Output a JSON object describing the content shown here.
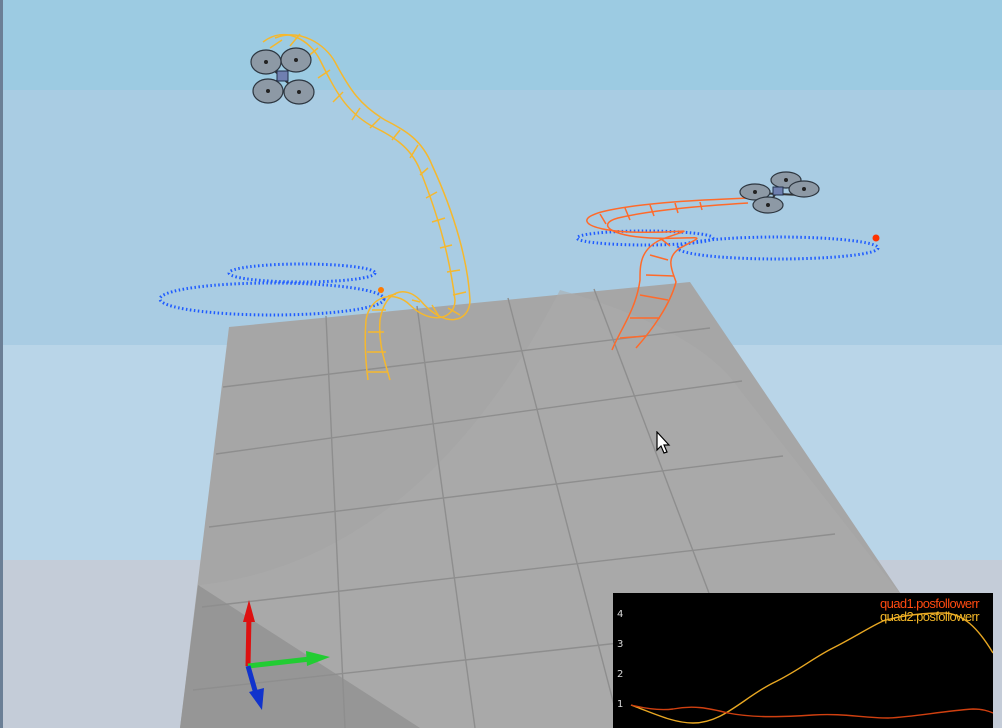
{
  "scene": {
    "sky_top_color": "#9ccbe2",
    "sky_mid_color": "#a9cce3",
    "sky_low_color": "#b9d5e8",
    "horizon_color": "#c4ccd8",
    "floor_color": "#a4a4a4",
    "trail_colors": {
      "quad1": "#ff6a2a",
      "quad2": "#f5b82e"
    },
    "target_path_color": "#1f5cff",
    "axis_colors": {
      "x": "#22cc33",
      "y": "#dd1111",
      "z": "#1133cc"
    },
    "drone_icon": "quadrotor-icon",
    "cursor_icon": "mouse-pointer-icon"
  },
  "plot": {
    "background": "#000000",
    "legend": [
      {
        "label": "quad1.posfollowerr",
        "color": "#ff4a10"
      },
      {
        "label": "quad2.posfollowerr",
        "color": "#f2b628"
      }
    ],
    "y_ticks": [
      "4",
      "3",
      "2",
      "1"
    ]
  }
}
